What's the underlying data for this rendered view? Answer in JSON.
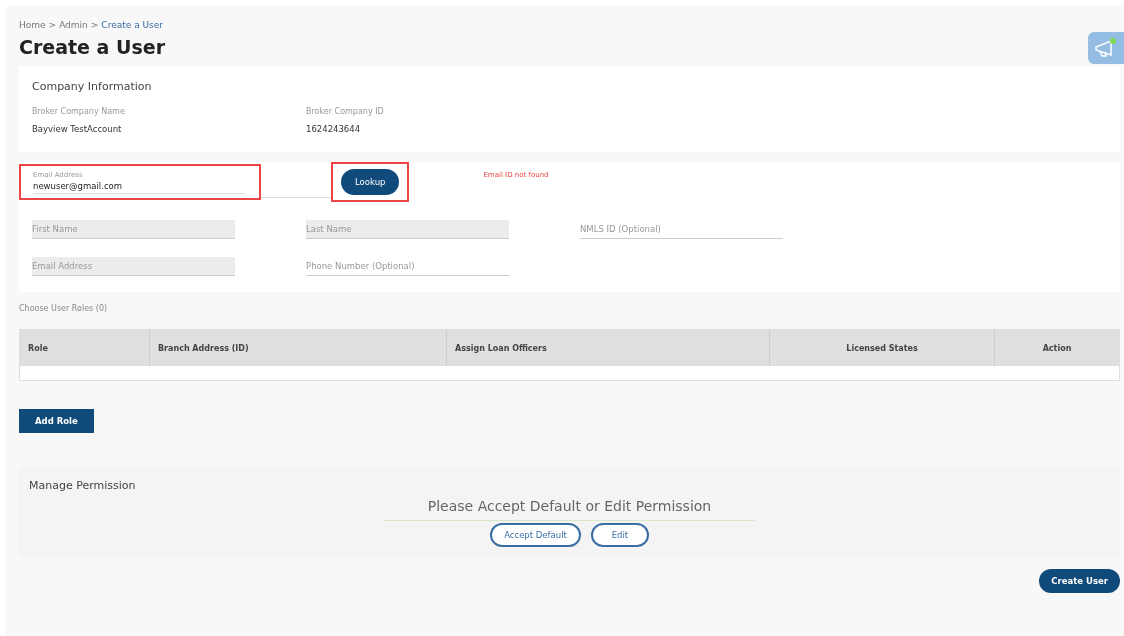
{
  "breadcrumb": [
    {
      "label": "Home",
      "current": false
    },
    {
      "label": "Admin",
      "current": false
    },
    {
      "label": "Create a User",
      "current": true
    }
  ],
  "breadcrumb_separator": ">",
  "title": "Create a User",
  "company": {
    "heading": "Company Information",
    "fields": [
      {
        "label": "Broker Company Name",
        "value": "Bayview TestAccount"
      },
      {
        "label": "Broker Company ID",
        "value": "1624243644"
      }
    ]
  },
  "lookup": {
    "label": "Email Address",
    "value": "newuser@gmail.com",
    "button": "Lookup",
    "error": "Email ID not found"
  },
  "user_fields": [
    [
      {
        "placeholder": "First Name",
        "filled": true
      },
      {
        "placeholder": "Last Name",
        "filled": true
      },
      {
        "placeholder": "NMLS ID (Optional)",
        "filled": false
      }
    ],
    [
      {
        "placeholder": "Email Address",
        "filled": true
      },
      {
        "placeholder": "Phone Number (Optional)",
        "filled": false
      }
    ]
  ],
  "roles": {
    "heading": "Choose User Roles (0)",
    "columns": [
      "Role",
      "Branch Address (ID)",
      "Assign Loan Officers",
      "Licensed States",
      "Action"
    ],
    "add_button": "Add Role"
  },
  "permission": {
    "heading": "Manage Permission",
    "prompt": "Please Accept Default or Edit Permission",
    "buttons": [
      "Accept Default",
      "Edit"
    ]
  },
  "submit": "Create User"
}
